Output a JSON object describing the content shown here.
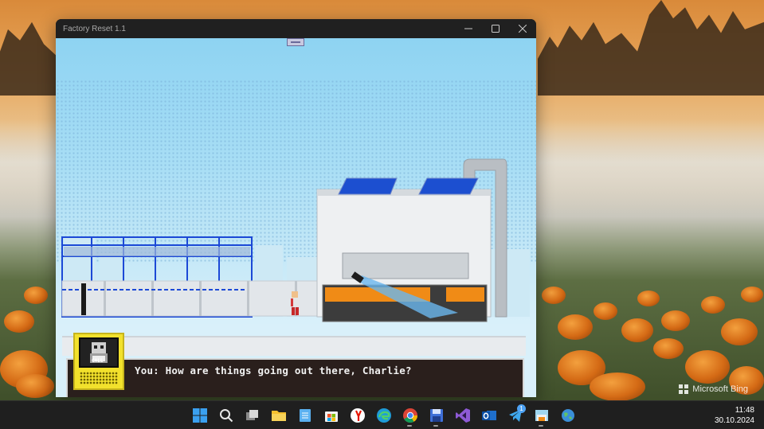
{
  "window": {
    "title": "Factory Reset 1.1",
    "minimize_icon": "minimize-icon",
    "maximize_icon": "maximize-icon",
    "close_icon": "close-icon"
  },
  "game": {
    "dialog": {
      "text": "You: How are things going out there, Charlie?",
      "portrait_label": "CALL"
    },
    "colors": {
      "sky": "#8ed3f2",
      "panel_bg": "#2a1f1c",
      "portrait": "#f2e12c",
      "fence": "#1c49d6"
    }
  },
  "wallpaper": {
    "watermark": "Microsoft Bing"
  },
  "taskbar": {
    "apps": [
      {
        "name": "start",
        "icon": "windows-start-icon",
        "running": false
      },
      {
        "name": "search",
        "icon": "search-icon",
        "running": false
      },
      {
        "name": "task-view",
        "icon": "task-view-icon",
        "running": false
      },
      {
        "name": "file-explorer",
        "icon": "folder-icon",
        "running": false
      },
      {
        "name": "notepad",
        "icon": "notepad-icon",
        "running": false
      },
      {
        "name": "store",
        "icon": "store-icon",
        "running": false
      },
      {
        "name": "yandex",
        "icon": "yandex-browser-icon",
        "running": false
      },
      {
        "name": "edge",
        "icon": "edge-icon",
        "running": false
      },
      {
        "name": "chrome",
        "icon": "chrome-icon",
        "running": true
      },
      {
        "name": "save-app",
        "icon": "floppy-icon",
        "running": true
      },
      {
        "name": "visual-studio",
        "icon": "visual-studio-icon",
        "running": false
      },
      {
        "name": "outlook",
        "icon": "outlook-icon",
        "running": false
      },
      {
        "name": "telegram",
        "icon": "telegram-icon",
        "running": false,
        "badge": "1"
      },
      {
        "name": "game-app",
        "icon": "factory-reset-icon",
        "running": true
      },
      {
        "name": "globe-app",
        "icon": "globe-icon",
        "running": false
      }
    ],
    "time": "11:48",
    "date": "30.10.2024"
  }
}
